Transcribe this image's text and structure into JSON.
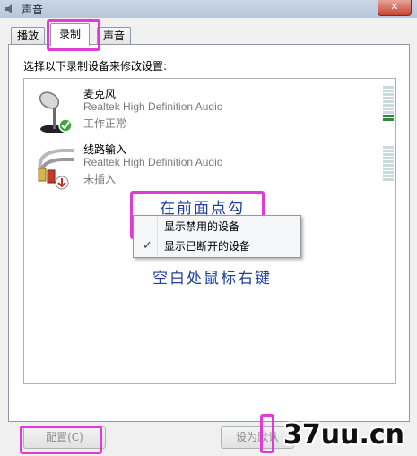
{
  "window": {
    "title": "声音",
    "close_glyph": "✕"
  },
  "tabs": [
    {
      "label": "播放"
    },
    {
      "label": "录制"
    },
    {
      "label": "声音"
    }
  ],
  "instruction": "选择以下录制设备来修改设置:",
  "devices": [
    {
      "name": "麦克风",
      "driver": "Realtek High Definition Audio",
      "status": "工作正常",
      "icon": "microphone-icon",
      "badge": "check-badge-icon",
      "level": 0.15
    },
    {
      "name": "线路输入",
      "driver": "Realtek High Definition Audio",
      "status": "未插入",
      "icon": "line-in-cable-icon",
      "badge": "unplugged-badge-icon",
      "level": 0
    }
  ],
  "context_menu": {
    "items": [
      {
        "label": "显示禁用的设备",
        "checked": false
      },
      {
        "label": "显示已断开的设备",
        "checked": true
      }
    ],
    "check_glyph": "✓"
  },
  "annotations": {
    "top_note": "在前面点勾",
    "bottom_note": "空白处鼠标右键",
    "color": "#e23ad6"
  },
  "buttons": {
    "configure": "配置(C)",
    "set_default": "设为默认"
  },
  "watermark": "37uu.cn"
}
